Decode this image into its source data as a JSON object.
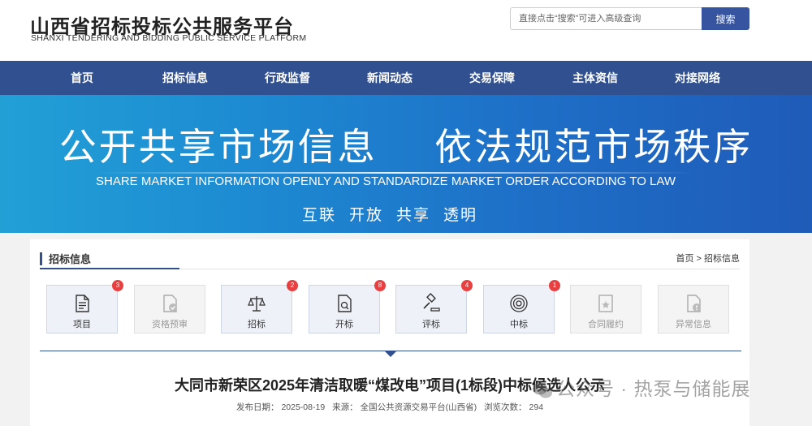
{
  "header": {
    "title": "山西省招标投标公共服务平台",
    "subtitle": "SHANXI TENDERING AND BIDDING PUBLIC SERVICE PLATFORM",
    "search_placeholder": "直接点击“搜索”可进入高级查询",
    "search_button": "搜索"
  },
  "nav": {
    "items": [
      "首页",
      "招标信息",
      "行政监督",
      "新闻动态",
      "交易保障",
      "主体资信",
      "对接网络"
    ]
  },
  "banner": {
    "slogan": "公开共享市场信息    依法规范市场秩序",
    "english": "SHARE MARKET INFORMATION OPENLY AND STANDARDIZE MARKET ORDER ACCORDING TO LAW",
    "keywords": [
      "互联",
      "开放",
      "共享",
      "透明"
    ]
  },
  "section": {
    "title": "招标信息",
    "breadcrumb": "首页 > 招标信息"
  },
  "steps": [
    {
      "label": "项目",
      "badge": "3",
      "icon": "document-icon",
      "active": true
    },
    {
      "label": "资格预审",
      "badge": "",
      "icon": "file-check-icon",
      "active": false
    },
    {
      "label": "招标",
      "badge": "2",
      "icon": "scales-icon",
      "active": true
    },
    {
      "label": "开标",
      "badge": "8",
      "icon": "file-search-icon",
      "active": true
    },
    {
      "label": "评标",
      "badge": "4",
      "icon": "gavel-icon",
      "active": true
    },
    {
      "label": "中标",
      "badge": "1",
      "icon": "target-icon",
      "active": true
    },
    {
      "label": "合同履约",
      "badge": "",
      "icon": "contract-icon",
      "active": false
    },
    {
      "label": "异常信息",
      "badge": "",
      "icon": "warning-file-icon",
      "active": false
    }
  ],
  "article": {
    "title": "大同市新荣区2025年清洁取暖“煤改电”项目(1标段)中标候选人公示",
    "meta": {
      "publish_label": "发布日期：",
      "publish_date": "2025-08-19",
      "source_label": "来源：",
      "source": "全国公共资源交易平台(山西省)",
      "views_label": "浏览次数：",
      "views": "294"
    }
  },
  "watermark": "公众号 · 热泵与储能展",
  "colors": {
    "nav": "#31508f",
    "badge": "#e84040",
    "accent": "#3754a0"
  }
}
